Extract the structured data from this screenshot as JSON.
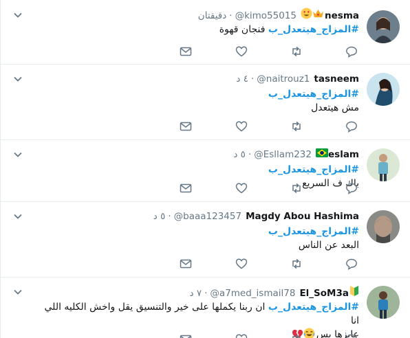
{
  "tweets": [
    {
      "name": "nesma",
      "handle": "@kimo55015",
      "time": "دقيقتان",
      "hashtag": "#المزاج_هيتعدل_ب",
      "text": "فنجان قهوة",
      "text_line2": "",
      "name_emojis": [
        "heart-eyes",
        "crown"
      ],
      "avatar": "woman-avatar-1"
    },
    {
      "name": "tasneem",
      "handle": "@naitrouz1",
      "time": "٤ د",
      "hashtag": "#المزاج_هيتعدل_ب",
      "text": "",
      "text_line2": "مش هيتعدل",
      "name_emojis": [],
      "avatar": "woman-avatar-2"
    },
    {
      "name": "eslam",
      "handle": "@Esllam232",
      "time": "٥ د",
      "hashtag": "#المزاج_هيتعدل_ب",
      "text": "باك ف السريع",
      "text_line2": "",
      "name_emojis": [
        "brazil-flag"
      ],
      "avatar": "man-avatar-1"
    },
    {
      "name": "Magdy Abou Hashima",
      "handle": "@baaa123457",
      "time": "٥ د",
      "hashtag": "#المزاج_هيتعدل_ب",
      "text": "",
      "text_line2": "البعد عن الناس",
      "name_emojis": [],
      "avatar": "man-avatar-2"
    },
    {
      "name": "El_SoM3a",
      "handle": "@a7med_ismail78",
      "time": "٧ د",
      "hashtag": "#المزاج_هيتعدل_ب",
      "text": "ان ربنا يكملها على خير والتنسيق يقل واخش الكليه اللي انا",
      "text_line2": "عايزها بس",
      "name_emojis": [
        "beginner-badge"
      ],
      "text2_emojis": [
        "joy",
        "broken-heart"
      ],
      "avatar": "man-avatar-3"
    }
  ],
  "colors": {
    "accent": "#1b95e0",
    "muted": "#657786",
    "icon": "#657786",
    "border": "#e6ecf0"
  },
  "action_icons": [
    "reply-icon",
    "retweet-icon",
    "like-icon",
    "message-icon"
  ]
}
